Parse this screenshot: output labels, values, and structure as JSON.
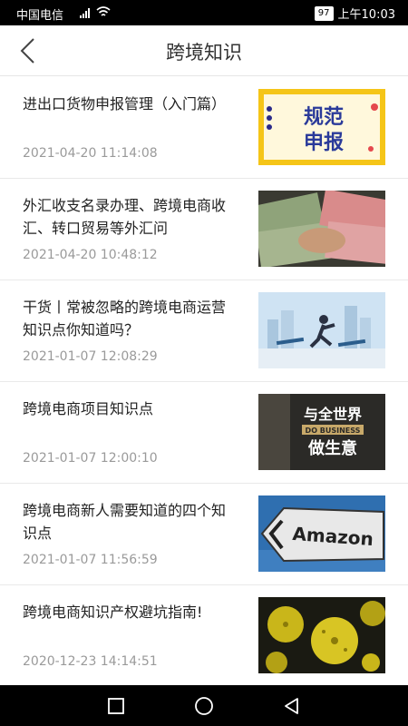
{
  "status": {
    "carrier": "中国电信",
    "battery": "97",
    "time": "上午10:03"
  },
  "header": {
    "title": "跨境知识",
    "back_icon": "chevron-left-icon"
  },
  "articles": [
    {
      "title": "进出口货物申报管理（入门篇）",
      "date": "2021-04-20 11:14:08",
      "thumb_text": [
        "规范",
        "申报"
      ]
    },
    {
      "title": "外汇收支名录办理、跨境电商收汇、转口贸易等外汇问",
      "date": "2021-04-20 10:48:12"
    },
    {
      "title": "干货丨常被忽略的跨境电商运营知识点你知道吗？",
      "date": "2021-01-07 12:08:29"
    },
    {
      "title": "跨境电商项目知识点",
      "date": "2021-01-07 12:00:10",
      "thumb_text": [
        "与全世界",
        "DO BUSINESS",
        "做生意"
      ]
    },
    {
      "title": "跨境电商新人需要知道的四个知识点",
      "date": "2021-01-07 11:56:59",
      "thumb_text": [
        "Amazon"
      ]
    },
    {
      "title": "跨境电商知识产权避坑指南!",
      "date": "2020-12-23 14:14:51"
    }
  ],
  "nav": {
    "recent_icon": "square-icon",
    "home_icon": "circle-icon",
    "back_icon": "triangle-back-icon"
  }
}
